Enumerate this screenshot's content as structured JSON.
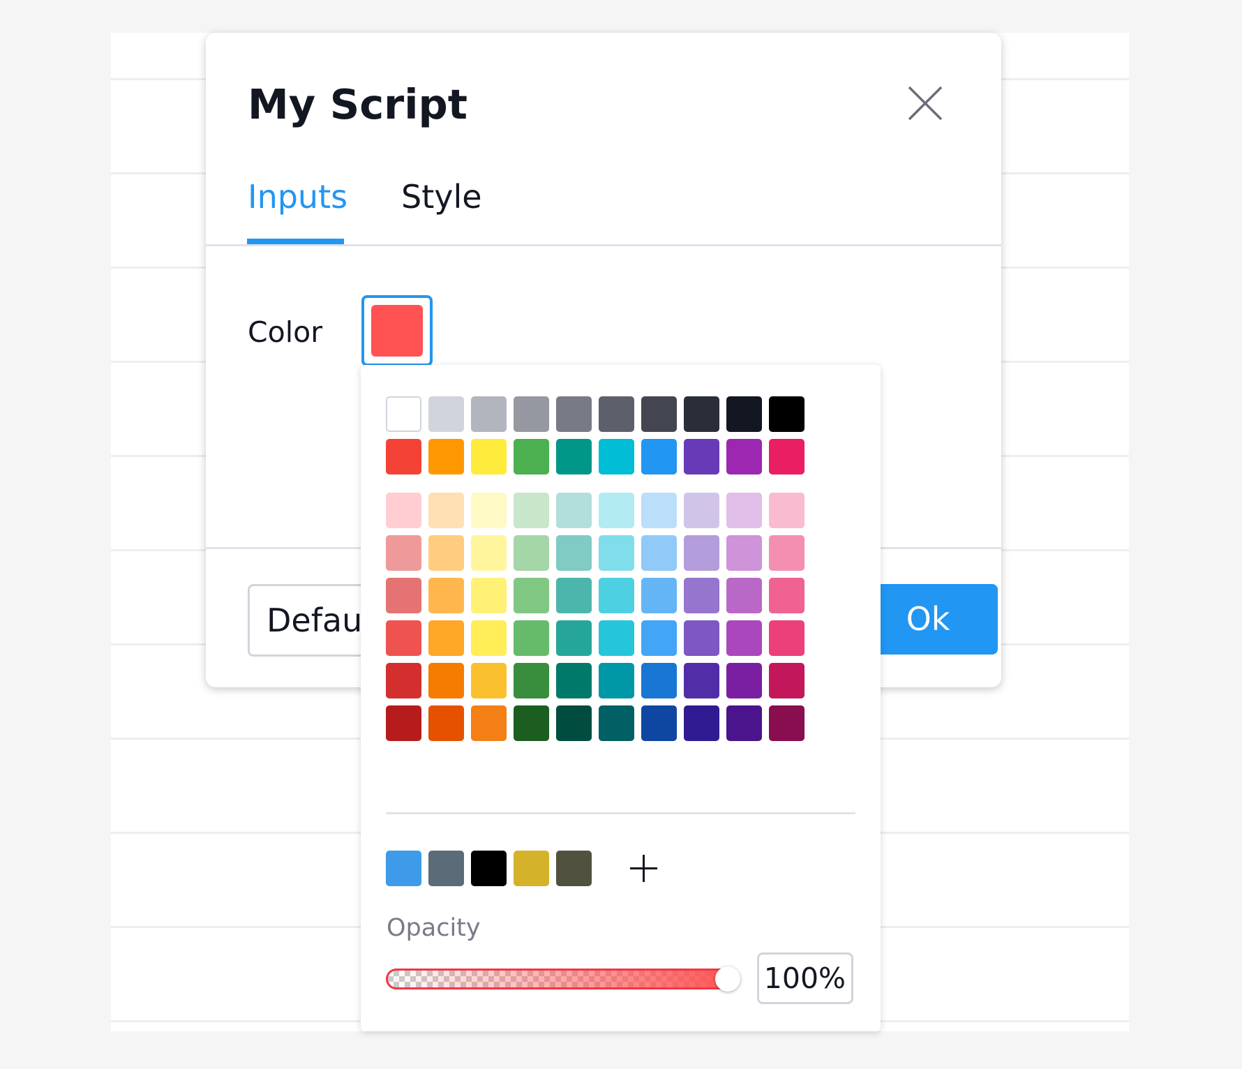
{
  "dialog": {
    "title": "My Script",
    "tabs": [
      {
        "label": "Inputs",
        "active": true
      },
      {
        "label": "Style",
        "active": false
      }
    ],
    "color_label": "Color",
    "selected_color": "#ff5252",
    "defaults_label": "Defaults",
    "ok_label": "Ok",
    "accent_color": "#2196f3"
  },
  "picker": {
    "palette_rows": [
      [
        "#ffffff",
        "#d1d4dc",
        "#b2b5be",
        "#9598a1",
        "#787b86",
        "#5d606b",
        "#434651",
        "#2a2e39",
        "#131722",
        "#000000"
      ],
      [
        "#f44336",
        "#ff9800",
        "#ffeb3b",
        "#4caf50",
        "#009688",
        "#00bcd4",
        "#2196f3",
        "#673ab7",
        "#9c27b0",
        "#e91e63"
      ],
      [
        "#ffcdd2",
        "#ffe0b2",
        "#fff9c4",
        "#c8e6c9",
        "#b2dfdb",
        "#b2ebf2",
        "#bbdefb",
        "#d1c4e9",
        "#e1bee7",
        "#f8bbd0"
      ],
      [
        "#ef9a9a",
        "#ffcc80",
        "#fff59d",
        "#a5d6a7",
        "#80cbc4",
        "#80deea",
        "#90caf9",
        "#b39ddb",
        "#ce93d8",
        "#f48fb1"
      ],
      [
        "#e57373",
        "#ffb74d",
        "#fff176",
        "#81c784",
        "#4db6ac",
        "#4dd0e1",
        "#64b5f6",
        "#9575cd",
        "#ba68c8",
        "#f06292"
      ],
      [
        "#ef5350",
        "#ffa726",
        "#ffee58",
        "#66bb6a",
        "#26a69a",
        "#26c6da",
        "#42a5f5",
        "#7e57c2",
        "#ab47bc",
        "#ec407a"
      ],
      [
        "#d32f2f",
        "#f57c00",
        "#fbc02d",
        "#388e3c",
        "#00796b",
        "#0097a7",
        "#1976d2",
        "#512da8",
        "#7b1fa2",
        "#c2185b"
      ],
      [
        "#b71c1c",
        "#e65100",
        "#f57f17",
        "#1b5e20",
        "#004d40",
        "#006064",
        "#0d47a1",
        "#311b92",
        "#4a148c",
        "#880e4f"
      ]
    ],
    "custom_colors": [
      "#3d9be9",
      "#5b6b78",
      "#000000",
      "#d4b32a",
      "#50523f"
    ],
    "add_icon": "plus-icon",
    "opacity_label": "Opacity",
    "opacity_value": "100%",
    "opacity_fraction": 1.0
  }
}
